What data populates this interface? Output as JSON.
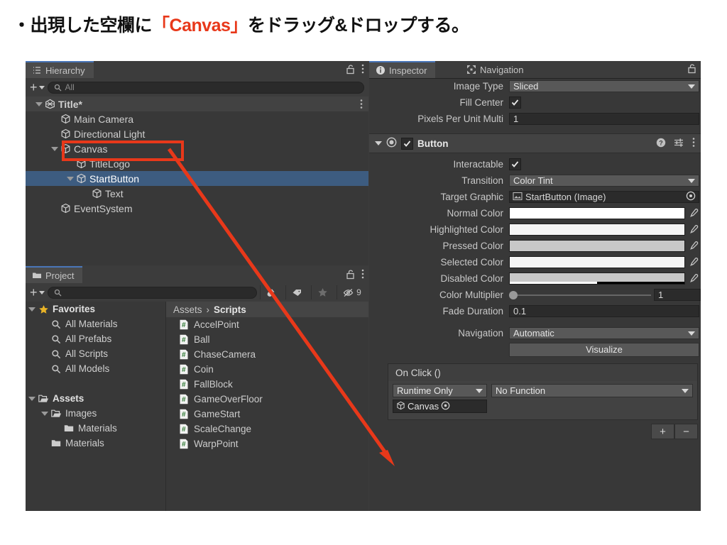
{
  "caption": {
    "prefix": "・出現した空欄に",
    "highlight": "「Canvas」",
    "suffix": "をドラッグ&ドロップする。",
    "highlight_color": "#e8381a"
  },
  "hierarchy": {
    "tab_label": "Hierarchy",
    "tab_icon": "hierarchy-icon",
    "add_label": "+",
    "search_placeholder": "All",
    "items": [
      {
        "label": "Title*",
        "indent": 0,
        "icon": "unity-scene-icon",
        "expanded": true,
        "selected": false,
        "scene": true
      },
      {
        "label": "Main Camera",
        "indent": 1,
        "icon": "gameobject-cube-icon",
        "expanded": null,
        "selected": false,
        "scene": false
      },
      {
        "label": "Directional Light",
        "indent": 1,
        "icon": "gameobject-cube-icon",
        "expanded": null,
        "selected": false,
        "scene": false
      },
      {
        "label": "Canvas",
        "indent": 1,
        "icon": "gameobject-cube-icon",
        "expanded": true,
        "selected": false,
        "scene": false
      },
      {
        "label": "TitleLogo",
        "indent": 2,
        "icon": "gameobject-cube-icon",
        "expanded": null,
        "selected": false,
        "scene": false
      },
      {
        "label": "StartButton",
        "indent": 2,
        "icon": "gameobject-cube-icon",
        "expanded": true,
        "selected": true,
        "scene": false
      },
      {
        "label": "Text",
        "indent": 3,
        "icon": "gameobject-cube-icon",
        "expanded": null,
        "selected": false,
        "scene": false
      },
      {
        "label": "EventSystem",
        "indent": 1,
        "icon": "gameobject-cube-icon",
        "expanded": null,
        "selected": false,
        "scene": false
      }
    ]
  },
  "project": {
    "tab_label": "Project",
    "tab_icon": "folder-icon",
    "add_label": "+",
    "search_placeholder": "",
    "hidden_count": "9",
    "tree": [
      {
        "label": "Favorites",
        "indent": 0,
        "icon": "star-icon",
        "expanded": true,
        "bold": true
      },
      {
        "label": "All Materials",
        "indent": 1,
        "icon": "search-icon",
        "expanded": null,
        "bold": false
      },
      {
        "label": "All Prefabs",
        "indent": 1,
        "icon": "search-icon",
        "expanded": null,
        "bold": false
      },
      {
        "label": "All Scripts",
        "indent": 1,
        "icon": "search-icon",
        "expanded": null,
        "bold": false
      },
      {
        "label": "All Models",
        "indent": 1,
        "icon": "search-icon",
        "expanded": null,
        "bold": false
      },
      {
        "label": "",
        "indent": 0,
        "icon": "",
        "expanded": null,
        "bold": false
      },
      {
        "label": "Assets",
        "indent": 0,
        "icon": "folder-open-icon",
        "expanded": true,
        "bold": true
      },
      {
        "label": "Images",
        "indent": 1,
        "icon": "folder-open-icon",
        "expanded": true,
        "bold": false
      },
      {
        "label": "Materials",
        "indent": 2,
        "icon": "folder-icon",
        "expanded": null,
        "bold": false
      },
      {
        "label": "Materials",
        "indent": 1,
        "icon": "folder-icon",
        "expanded": null,
        "bold": false
      }
    ],
    "breadcrumb_root": "Assets",
    "breadcrumb_sep": "›",
    "breadcrumb_current": "Scripts",
    "assets": [
      {
        "label": "AccelPoint",
        "icon": "csharp-script-icon"
      },
      {
        "label": "Ball",
        "icon": "csharp-script-icon"
      },
      {
        "label": "ChaseCamera",
        "icon": "csharp-script-icon"
      },
      {
        "label": "Coin",
        "icon": "csharp-script-icon"
      },
      {
        "label": "FallBlock",
        "icon": "csharp-script-icon"
      },
      {
        "label": "GameOverFloor",
        "icon": "csharp-script-icon"
      },
      {
        "label": "GameStart",
        "icon": "csharp-script-icon"
      },
      {
        "label": "ScaleChange",
        "icon": "csharp-script-icon"
      },
      {
        "label": "WarpPoint",
        "icon": "csharp-script-icon"
      }
    ]
  },
  "inspector": {
    "tabs": [
      {
        "label": "Inspector",
        "icon": "info-icon",
        "active": true
      },
      {
        "label": "Navigation",
        "icon": "navigation-icon",
        "active": false
      }
    ],
    "image_section": [
      {
        "label": "Image Type",
        "value": "Sliced",
        "type": "popup",
        "indent": 0
      },
      {
        "label": "Fill Center",
        "value": "",
        "type": "checkbox",
        "checked": true,
        "indent": 1
      },
      {
        "label": "Pixels Per Unit Multi",
        "value": "1",
        "type": "text",
        "indent": 1
      }
    ],
    "component": {
      "name": "Button",
      "enabled": true,
      "expanded": true,
      "help_icon": "help-icon",
      "preset_icon": "preset-icon",
      "menu_icon": "kebab-menu-icon"
    },
    "button_rows": [
      {
        "label": "Interactable",
        "type": "checkbox",
        "checked": true,
        "indent": 0
      },
      {
        "label": "Transition",
        "type": "popup",
        "value": "Color Tint",
        "indent": 0
      },
      {
        "label": "Target Graphic",
        "type": "object",
        "value": "StartButton (Image)",
        "indent": 1
      },
      {
        "label": "Normal Color",
        "type": "color",
        "value": "#ffffff",
        "alpha": 100,
        "indent": 1
      },
      {
        "label": "Highlighted Color",
        "type": "color",
        "value": "#f5f5f5",
        "alpha": 100,
        "indent": 1
      },
      {
        "label": "Pressed Color",
        "type": "color",
        "value": "#c8c8c8",
        "alpha": 100,
        "indent": 1
      },
      {
        "label": "Selected Color",
        "type": "color",
        "value": "#f5f5f5",
        "alpha": 100,
        "indent": 1
      },
      {
        "label": "Disabled Color",
        "type": "color",
        "value": "#c8c8c8",
        "alpha": 50,
        "indent": 1
      },
      {
        "label": "Color Multiplier",
        "type": "slider",
        "value": "1",
        "indent": 1
      },
      {
        "label": "Fade Duration",
        "type": "text",
        "value": "0.1",
        "indent": 1
      },
      {
        "label": "Navigation",
        "type": "popup",
        "value": "Automatic",
        "indent": 0
      }
    ],
    "visualize_label": "Visualize",
    "onclick": {
      "title": "On Click ()",
      "runtime_mode": "Runtime Only",
      "function": "No Function",
      "object": "Canvas",
      "object_icon": "gameobject-cube-icon",
      "add_label": "+",
      "remove_label": "−"
    }
  },
  "annotation": {
    "highlight_box_color": "#e8381a",
    "arrow_color": "#e8381a",
    "arrow_from": "Canvas hierarchy item",
    "arrow_to": "On Click object slot"
  }
}
